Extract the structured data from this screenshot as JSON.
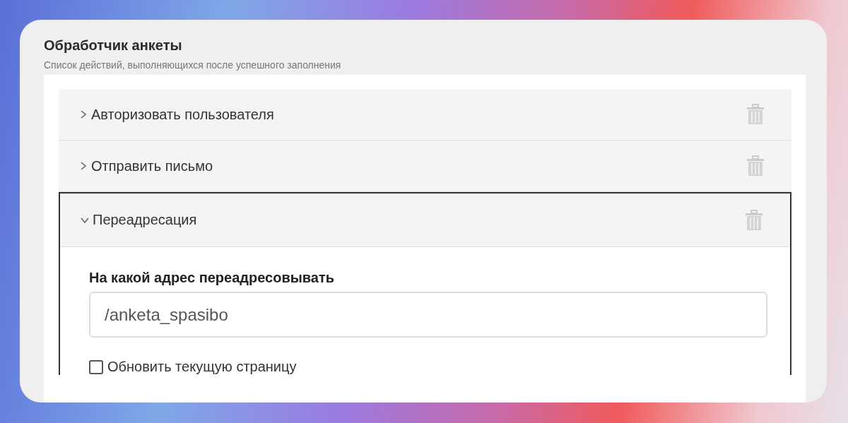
{
  "panel": {
    "title": "Обработчик анкеты",
    "subtitle": "Список действий, выполняющихся после успешного заполнения"
  },
  "actions": [
    {
      "label": "Авторизовать пользователя",
      "expanded": false
    },
    {
      "label": "Отправить письмо",
      "expanded": false
    },
    {
      "label": "Переадресация",
      "expanded": true,
      "field_label": "На какой адрес переадресовывать",
      "field_value": "/anketa_spasibo",
      "checkbox_label": "Обновить текущую страницу",
      "checked": false
    }
  ]
}
